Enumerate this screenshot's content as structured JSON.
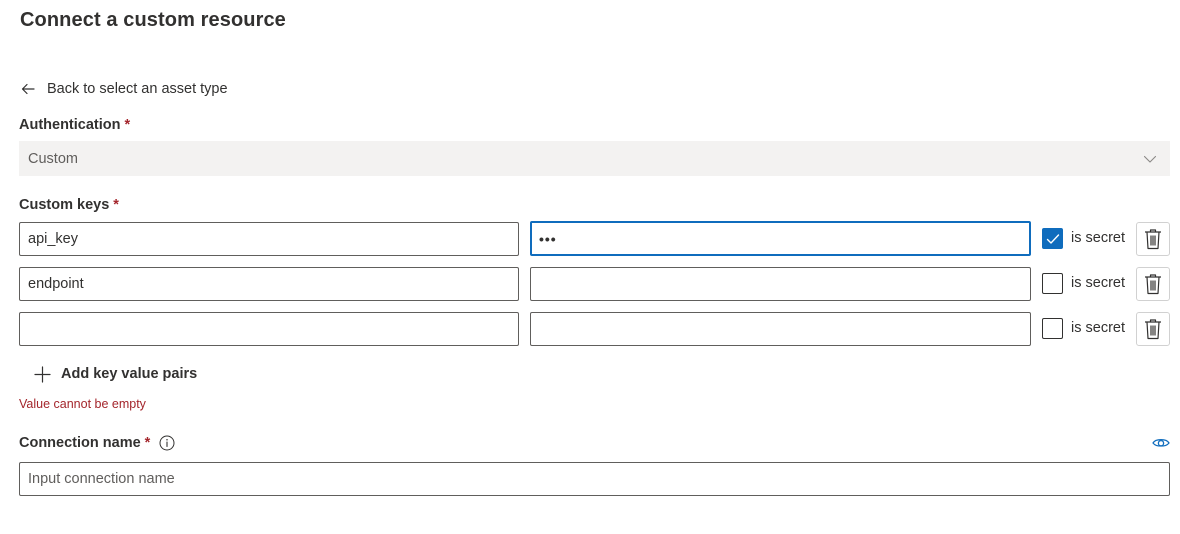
{
  "page": {
    "title": "Connect a custom resource"
  },
  "back": {
    "label": "Back to select an asset type"
  },
  "authentication": {
    "label": "Authentication",
    "required_mark": "*",
    "selected": "Custom"
  },
  "custom_keys": {
    "label": "Custom keys",
    "required_mark": "*",
    "secret_label": "is secret",
    "rows": [
      {
        "key": "api_key",
        "value_masked": "•••",
        "is_secret": true
      },
      {
        "key": "endpoint",
        "value_masked": "",
        "is_secret": false
      },
      {
        "key": "",
        "value_masked": "",
        "is_secret": false
      }
    ],
    "add_label": "Add key value pairs",
    "error": "Value cannot be empty"
  },
  "connection_name": {
    "label": "Connection name",
    "required_mark": "*",
    "placeholder": "Input connection name",
    "value": ""
  },
  "colors": {
    "accent": "#0f6cbd",
    "error": "#a4262c",
    "text": "#323130",
    "muted": "#605e5c",
    "field_bg": "#f3f2f1"
  },
  "icons": {
    "back": "arrow-left-icon",
    "dropdown": "chevron-down-icon",
    "checkbox": "checkmark-icon",
    "delete": "trash-icon",
    "add": "plus-icon",
    "info": "info-icon",
    "reveal": "eye-icon"
  }
}
